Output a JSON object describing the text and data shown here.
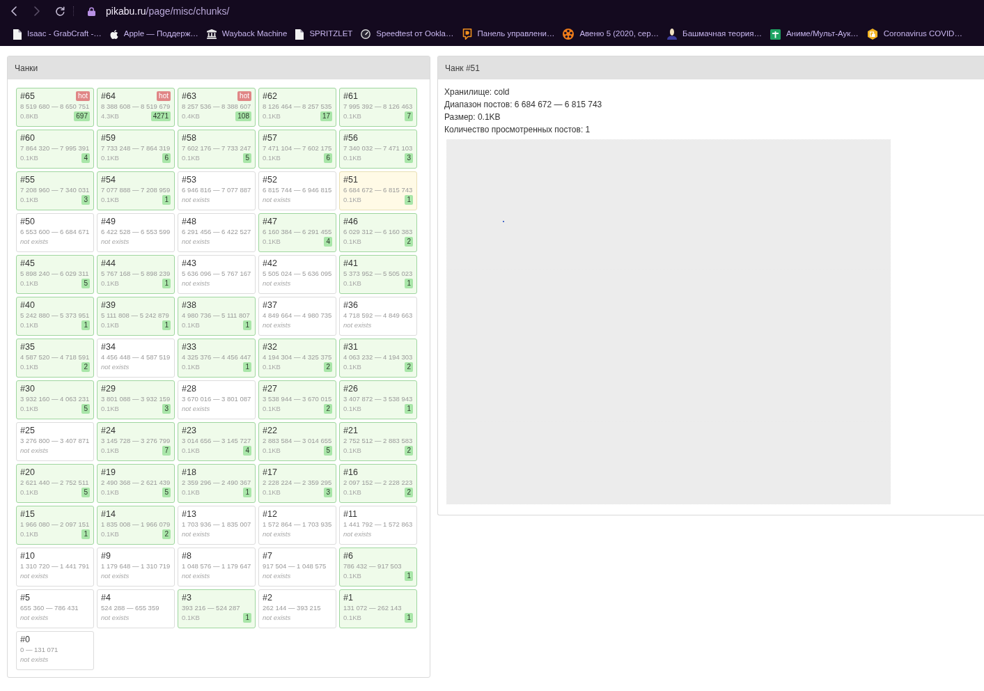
{
  "browser": {
    "nav": [
      {
        "kind": "back",
        "disabled": false
      },
      {
        "kind": "forward",
        "disabled": true
      },
      {
        "kind": "reload",
        "disabled": false
      }
    ],
    "address": {
      "host": "pikabu.ru",
      "path": "/page/misc/chunks/"
    },
    "bookmarks": [
      {
        "title": "Isaac - GrabCraft -…",
        "kind": "document"
      },
      {
        "title": "Apple — Поддерж…",
        "kind": "apple"
      },
      {
        "title": "Wayback Machine",
        "kind": "museum"
      },
      {
        "title": "SPRITZLET",
        "kind": "document"
      },
      {
        "title": "Speedtest от Ookla…",
        "kind": "gauge"
      },
      {
        "title": "Панель управлени…",
        "kind": "bubble"
      },
      {
        "title": "Авеню 5 (2020, сер…",
        "kind": "reel"
      },
      {
        "title": "Башмачная теория…",
        "kind": "person"
      },
      {
        "title": "Аниме/Мульт-Аук…",
        "kind": "sheet"
      },
      {
        "title": "Coronavirus COVID…",
        "kind": "hexagon"
      }
    ]
  },
  "chunks_panel": {
    "title": "Чанки",
    "chunks": [
      {
        "id": "#65",
        "range": "8 519 680 — 8 650 751",
        "kind": "stored",
        "size": "0.8KB",
        "views": "697",
        "badge": "hot",
        "selected": false
      },
      {
        "id": "#64",
        "range": "8 388 608 — 8 519 679",
        "kind": "stored",
        "size": "4.3KB",
        "views": "4271",
        "badge": "hot",
        "selected": false
      },
      {
        "id": "#63",
        "range": "8 257 536 — 8 388 607",
        "kind": "stored",
        "size": "0.4KB",
        "views": "108",
        "badge": "hot",
        "selected": false
      },
      {
        "id": "#62",
        "range": "8 126 464 — 8 257 535",
        "kind": "stored",
        "size": "0.1KB",
        "views": "17",
        "selected": false
      },
      {
        "id": "#61",
        "range": "7 995 392 — 8 126 463",
        "kind": "stored",
        "size": "0.1KB",
        "views": "7",
        "selected": false
      },
      {
        "id": "#60",
        "range": "7 864 320 — 7 995 391",
        "kind": "stored",
        "size": "0.1KB",
        "views": "4",
        "selected": false
      },
      {
        "id": "#59",
        "range": "7 733 248 — 7 864 319",
        "kind": "stored",
        "size": "0.1KB",
        "views": "6",
        "selected": false
      },
      {
        "id": "#58",
        "range": "7 602 176 — 7 733 247",
        "kind": "stored",
        "size": "0.1KB",
        "views": "5",
        "selected": false
      },
      {
        "id": "#57",
        "range": "7 471 104 — 7 602 175",
        "kind": "stored",
        "size": "0.1KB",
        "views": "6",
        "selected": false
      },
      {
        "id": "#56",
        "range": "7 340 032 — 7 471 103",
        "kind": "stored",
        "size": "0.1KB",
        "views": "3",
        "selected": false
      },
      {
        "id": "#55",
        "range": "7 208 960 — 7 340 031",
        "kind": "stored",
        "size": "0.1KB",
        "views": "3",
        "selected": false
      },
      {
        "id": "#54",
        "range": "7 077 888 — 7 208 959",
        "kind": "stored",
        "size": "0.1KB",
        "views": "1",
        "selected": false
      },
      {
        "id": "#53",
        "range": "6 946 816 — 7 077 887",
        "kind": "missing",
        "status": "not exists",
        "selected": false
      },
      {
        "id": "#52",
        "range": "6 815 744 — 6 946 815",
        "kind": "missing",
        "status": "not exists",
        "selected": false
      },
      {
        "id": "#51",
        "range": "6 684 672 — 6 815 743",
        "kind": "stored",
        "size": "0.1KB",
        "views": "1",
        "selected": true
      },
      {
        "id": "#50",
        "range": "6 553 600 — 6 684 671",
        "kind": "missing",
        "status": "not exists",
        "selected": false
      },
      {
        "id": "#49",
        "range": "6 422 528 — 6 553 599",
        "kind": "missing",
        "status": "not exists",
        "selected": false
      },
      {
        "id": "#48",
        "range": "6 291 456 — 6 422 527",
        "kind": "missing",
        "status": "not exists",
        "selected": false
      },
      {
        "id": "#47",
        "range": "6 160 384 — 6 291 455",
        "kind": "stored",
        "size": "0.1KB",
        "views": "4",
        "selected": false
      },
      {
        "id": "#46",
        "range": "6 029 312 — 6 160 383",
        "kind": "stored",
        "size": "0.1KB",
        "views": "2",
        "selected": false
      },
      {
        "id": "#45",
        "range": "5 898 240 — 6 029 311",
        "kind": "stored",
        "size": "0.1KB",
        "views": "5",
        "selected": false
      },
      {
        "id": "#44",
        "range": "5 767 168 — 5 898 239",
        "kind": "stored",
        "size": "0.1KB",
        "views": "1",
        "selected": false
      },
      {
        "id": "#43",
        "range": "5 636 096 — 5 767 167",
        "kind": "missing",
        "status": "not exists",
        "selected": false
      },
      {
        "id": "#42",
        "range": "5 505 024 — 5 636 095",
        "kind": "missing",
        "status": "not exists",
        "selected": false
      },
      {
        "id": "#41",
        "range": "5 373 952 — 5 505 023",
        "kind": "stored",
        "size": "0.1KB",
        "views": "1",
        "selected": false
      },
      {
        "id": "#40",
        "range": "5 242 880 — 5 373 951",
        "kind": "stored",
        "size": "0.1KB",
        "views": "1",
        "selected": false
      },
      {
        "id": "#39",
        "range": "5 111 808 — 5 242 879",
        "kind": "stored",
        "size": "0.1KB",
        "views": "1",
        "selected": false
      },
      {
        "id": "#38",
        "range": "4 980 736 — 5 111 807",
        "kind": "stored",
        "size": "0.1KB",
        "views": "1",
        "selected": false
      },
      {
        "id": "#37",
        "range": "4 849 664 — 4 980 735",
        "kind": "missing",
        "status": "not exists",
        "selected": false
      },
      {
        "id": "#36",
        "range": "4 718 592 — 4 849 663",
        "kind": "missing",
        "status": "not exists",
        "selected": false
      },
      {
        "id": "#35",
        "range": "4 587 520 — 4 718 591",
        "kind": "stored",
        "size": "0.1KB",
        "views": "2",
        "selected": false
      },
      {
        "id": "#34",
        "range": "4 456 448 — 4 587 519",
        "kind": "missing",
        "status": "not exists",
        "selected": false
      },
      {
        "id": "#33",
        "range": "4 325 376 — 4 456 447",
        "kind": "stored",
        "size": "0.1KB",
        "views": "1",
        "selected": false
      },
      {
        "id": "#32",
        "range": "4 194 304 — 4 325 375",
        "kind": "stored",
        "size": "0.1KB",
        "views": "2",
        "selected": false
      },
      {
        "id": "#31",
        "range": "4 063 232 — 4 194 303",
        "kind": "stored",
        "size": "0.1KB",
        "views": "2",
        "selected": false
      },
      {
        "id": "#30",
        "range": "3 932 160 — 4 063 231",
        "kind": "stored",
        "size": "0.1KB",
        "views": "5",
        "selected": false
      },
      {
        "id": "#29",
        "range": "3 801 088 — 3 932 159",
        "kind": "stored",
        "size": "0.1KB",
        "views": "3",
        "selected": false
      },
      {
        "id": "#28",
        "range": "3 670 016 — 3 801 087",
        "kind": "missing",
        "status": "not exists",
        "selected": false
      },
      {
        "id": "#27",
        "range": "3 538 944 — 3 670 015",
        "kind": "stored",
        "size": "0.1KB",
        "views": "2",
        "selected": false
      },
      {
        "id": "#26",
        "range": "3 407 872 — 3 538 943",
        "kind": "stored",
        "size": "0.1KB",
        "views": "1",
        "selected": false
      },
      {
        "id": "#25",
        "range": "3 276 800 — 3 407 871",
        "kind": "missing",
        "status": "not exists",
        "selected": false
      },
      {
        "id": "#24",
        "range": "3 145 728 — 3 276 799",
        "kind": "stored",
        "size": "0.1KB",
        "views": "7",
        "selected": false
      },
      {
        "id": "#23",
        "range": "3 014 656 — 3 145 727",
        "kind": "stored",
        "size": "0.1KB",
        "views": "4",
        "selected": false
      },
      {
        "id": "#22",
        "range": "2 883 584 — 3 014 655",
        "kind": "stored",
        "size": "0.1KB",
        "views": "5",
        "selected": false
      },
      {
        "id": "#21",
        "range": "2 752 512 — 2 883 583",
        "kind": "stored",
        "size": "0.1KB",
        "views": "2",
        "selected": false
      },
      {
        "id": "#20",
        "range": "2 621 440 — 2 752 511",
        "kind": "stored",
        "size": "0.1KB",
        "views": "5",
        "selected": false
      },
      {
        "id": "#19",
        "range": "2 490 368 — 2 621 439",
        "kind": "stored",
        "size": "0.1KB",
        "views": "5",
        "selected": false
      },
      {
        "id": "#18",
        "range": "2 359 296 — 2 490 367",
        "kind": "stored",
        "size": "0.1KB",
        "views": "1",
        "selected": false
      },
      {
        "id": "#17",
        "range": "2 228 224 — 2 359 295",
        "kind": "stored",
        "size": "0.1KB",
        "views": "3",
        "selected": false
      },
      {
        "id": "#16",
        "range": "2 097 152 — 2 228 223",
        "kind": "stored",
        "size": "0.1KB",
        "views": "2",
        "selected": false
      },
      {
        "id": "#15",
        "range": "1 966 080 — 2 097 151",
        "kind": "stored",
        "size": "0.1KB",
        "views": "1",
        "selected": false
      },
      {
        "id": "#14",
        "range": "1 835 008 — 1 966 079",
        "kind": "stored",
        "size": "0.1KB",
        "views": "2",
        "selected": false
      },
      {
        "id": "#13",
        "range": "1 703 936 — 1 835 007",
        "kind": "missing",
        "status": "not exists",
        "selected": false
      },
      {
        "id": "#12",
        "range": "1 572 864 — 1 703 935",
        "kind": "missing",
        "status": "not exists",
        "selected": false
      },
      {
        "id": "#11",
        "range": "1 441 792 — 1 572 863",
        "kind": "missing",
        "status": "not exists",
        "selected": false
      },
      {
        "id": "#10",
        "range": "1 310 720 — 1 441 791",
        "kind": "missing",
        "status": "not exists",
        "selected": false
      },
      {
        "id": "#9",
        "range": "1 179 648 — 1 310 719",
        "kind": "missing",
        "status": "not exists",
        "selected": false
      },
      {
        "id": "#8",
        "range": "1 048 576 — 1 179 647",
        "kind": "missing",
        "status": "not exists",
        "selected": false
      },
      {
        "id": "#7",
        "range": "917 504 — 1 048 575",
        "kind": "missing",
        "status": "not exists",
        "selected": false
      },
      {
        "id": "#6",
        "range": "786 432 — 917 503",
        "kind": "stored",
        "size": "0.1KB",
        "views": "1",
        "selected": false
      },
      {
        "id": "#5",
        "range": "655 360 — 786 431",
        "kind": "missing",
        "status": "not exists",
        "selected": false
      },
      {
        "id": "#4",
        "range": "524 288 — 655 359",
        "kind": "missing",
        "status": "not exists",
        "selected": false
      },
      {
        "id": "#3",
        "range": "393 216 — 524 287",
        "kind": "stored",
        "size": "0.1KB",
        "views": "1",
        "selected": false
      },
      {
        "id": "#2",
        "range": "262 144 — 393 215",
        "kind": "missing",
        "status": "not exists",
        "selected": false
      },
      {
        "id": "#1",
        "range": "131 072 — 262 143",
        "kind": "stored",
        "size": "0.1KB",
        "views": "1",
        "selected": false
      },
      {
        "id": "#0",
        "range": "0 — 131 071",
        "kind": "missing",
        "status": "not exists",
        "selected": false
      }
    ]
  },
  "detail_panel": {
    "title": "Чанк #51",
    "lines": [
      "Хранилище: cold",
      "Диапазон постов: 6 684 672 — 6 815 743",
      "Размер: 0.1KB",
      "Количество просмотренных постов: 1"
    ]
  }
}
